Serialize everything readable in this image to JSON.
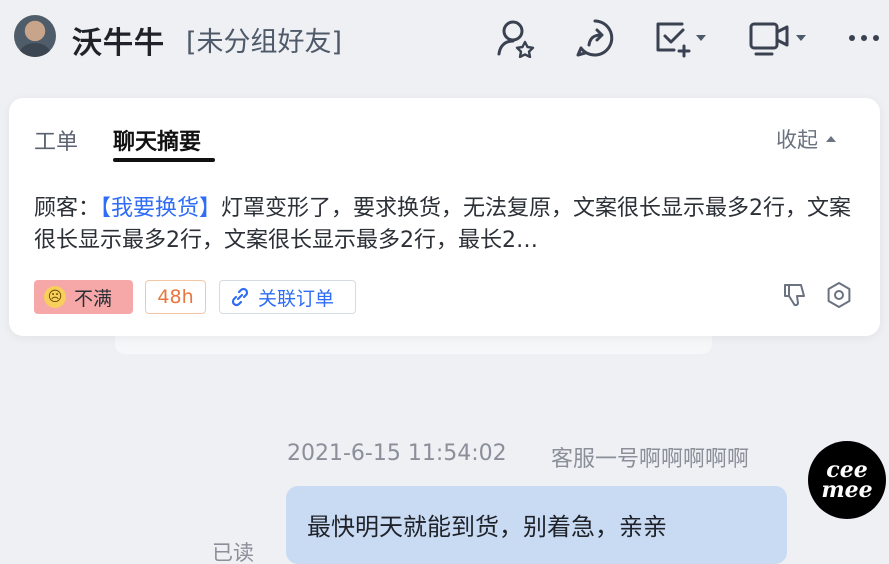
{
  "header": {
    "contact_name": "沃牛牛",
    "contact_group": "[未分组好友]",
    "icons": [
      "contact-star-icon",
      "share-icon",
      "task-add-icon",
      "video-call-icon",
      "more-icon"
    ]
  },
  "summary_card": {
    "tabs": [
      {
        "label": "工单",
        "active": false
      },
      {
        "label": "聊天摘要",
        "active": true
      }
    ],
    "collapse_label": "收起",
    "customer_prefix": "顾客：",
    "issue_tag": "【我要换货】",
    "summary_text": "灯罩变形了，要求换货，无法复原，文案很长显示最多2行，文案很长显示最多2行，文案很长显示最多2行，最长2…",
    "badges": {
      "sentiment": "不满",
      "sla": "48h",
      "link_order": "关联订单"
    }
  },
  "message": {
    "timestamp": "2021-6-15 11:54:02",
    "sender": "客服一号啊啊啊啊啊",
    "text": "最快明天就能到货，别着急，亲亲",
    "read_status": "已读",
    "avatar_text_line1": "cee",
    "avatar_text_line2": "mee"
  },
  "colors": {
    "accent_blue": "#2f6df6",
    "dissatisfied_bg": "#f6a7a7",
    "sla_orange": "#e8773c",
    "bubble_bg": "#c9daf3"
  }
}
